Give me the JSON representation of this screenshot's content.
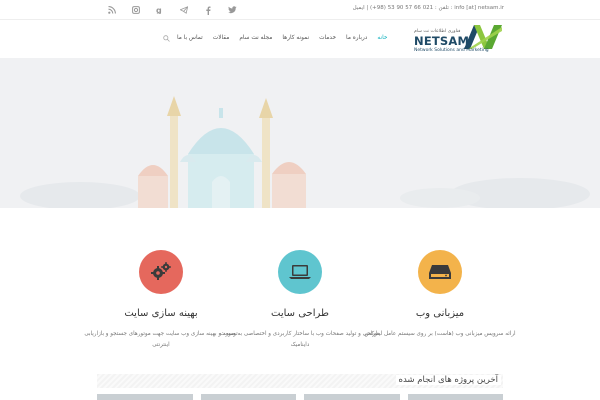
{
  "topbar": {
    "contact_text": "تلفن : 021 66 57 90 53 (98+) | ایمیل : info [at] netsam.ir",
    "social_icons": [
      "twitter-icon",
      "facebook-icon",
      "google-plus-icon",
      "instagram-icon",
      "telegram-icon",
      "rss-icon"
    ]
  },
  "logo": {
    "persian_line": "فناوری اطلاعات نت سام",
    "name": "NETSAM",
    "tagline": "Network Solutions and Marketing"
  },
  "nav": {
    "items": [
      {
        "label": "خانه",
        "active": true
      },
      {
        "label": "درباره ما",
        "active": false
      },
      {
        "label": "خدمات",
        "active": false
      },
      {
        "label": "نمونه کارها",
        "active": false
      },
      {
        "label": "مجله نت سام",
        "active": false
      },
      {
        "label": "مقالات",
        "active": false
      },
      {
        "label": "تماس با ما",
        "active": false
      }
    ],
    "active_color": "#18b4c1"
  },
  "features": [
    {
      "title": "بهینه سازی سایت",
      "desc": "توسعه و بهینه سازی وب سایت جهت موتورهای جستجو و بازاریابی اینترنتی",
      "icon": "gears-icon",
      "color": "#e5685d"
    },
    {
      "title": "طراحی سایت",
      "desc": "طراحی و تولید صفحات وب با ساختار کاربردی و اختصاصی به صورت داینامیک",
      "icon": "laptop-icon",
      "color": "#5fc5cf"
    },
    {
      "title": "میزبانی وب",
      "desc": "ارائه سرویس میزبانی وب (هاست) بر روی سیستم عامل لینوکس",
      "icon": "hard-drive-icon",
      "color": "#f3b34b"
    }
  ],
  "projects": {
    "title": "آخرین پروژه های انجام شده"
  }
}
